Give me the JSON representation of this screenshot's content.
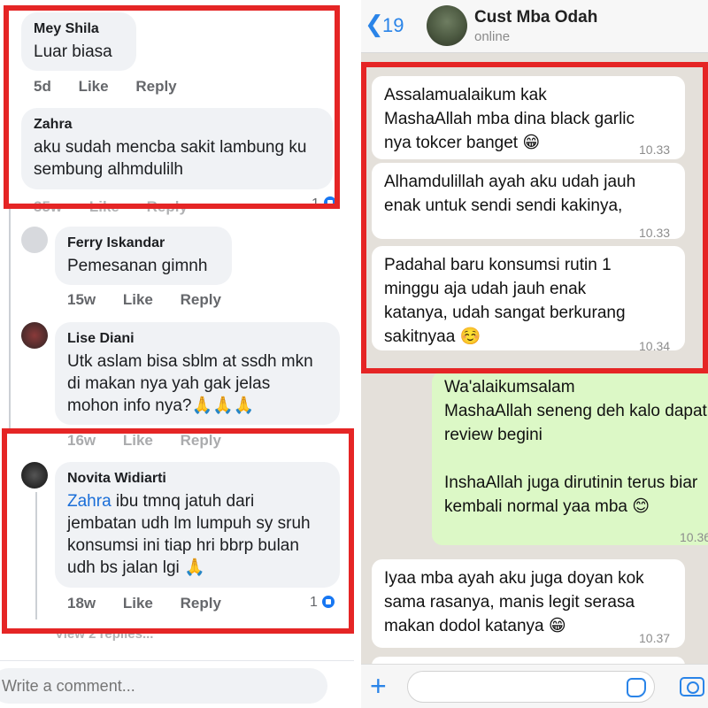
{
  "facebook": {
    "comments": [
      {
        "name": "Mey Shila",
        "lines": [
          "Luar biasa"
        ],
        "time": "5d",
        "like": "Like",
        "reply": "Reply"
      },
      {
        "name": "Zahra",
        "lines": [
          "aku sudah mencba sakit lambung ku",
          "sembung alhmdulilh"
        ],
        "time": "35w",
        "like": "Like",
        "reply": "Reply",
        "likes": "1"
      },
      {
        "name": "Ferry Iskandar",
        "lines": [
          "Pemesanan gimnh"
        ],
        "time": "15w",
        "like": "Like",
        "reply": "Reply"
      },
      {
        "name": "Lise Diani",
        "lines": [
          "Utk aslam bisa sblm at ssdh mkn",
          "di makan nya yah gak jelas",
          "mohon info nya?🙏🙏🙏"
        ],
        "time": "16w",
        "like": "Like",
        "reply": "Reply"
      },
      {
        "name": "Novita Widiarti",
        "mention": "Zahra",
        "lines": [
          " ibu tmnq jatuh dari",
          "jembatan udh lm lumpuh sy sruh",
          "konsumsi ini tiap hri bbrp bulan",
          "udh bs jalan lgi 🙏"
        ],
        "time": "18w",
        "like": "Like",
        "reply": "Reply",
        "likes": "1"
      }
    ],
    "view_replies": "View 2 replies...",
    "input_placeholder": "Write a comment..."
  },
  "whatsapp": {
    "back_count": "19",
    "contact_name": "Cust Mba Odah",
    "status": "online",
    "messages": [
      {
        "dir": "in",
        "lines": [
          "Assalamualaikum kak",
          "MashaAllah mba dina black garlic",
          "nya tokcer banget 😁"
        ],
        "time": "10.33"
      },
      {
        "dir": "in",
        "lines": [
          "Alhamdulillah ayah aku udah jauh",
          "enak untuk sendi sendi kakinya,"
        ],
        "time": "10.33"
      },
      {
        "dir": "in",
        "lines": [
          "Padahal baru konsumsi rutin 1",
          "minggu aja udah jauh enak",
          "katanya, udah sangat berkurang",
          "sakitnyaa ☺️"
        ],
        "time": "10.34"
      },
      {
        "dir": "out",
        "lines": [
          "Wa'alaikumsalam",
          "MashaAllah seneng deh kalo dapat",
          "review begini",
          "",
          "InshaAllah juga dirutinin terus biar",
          "kembali normal yaa mba 😊"
        ],
        "time": "10.36"
      },
      {
        "dir": "in",
        "lines": [
          "Iyaa mba ayah aku juga doyan kok",
          "sama rasanya, manis legit serasa",
          "makan dodol katanya 😁"
        ],
        "time": "10.37"
      }
    ]
  }
}
